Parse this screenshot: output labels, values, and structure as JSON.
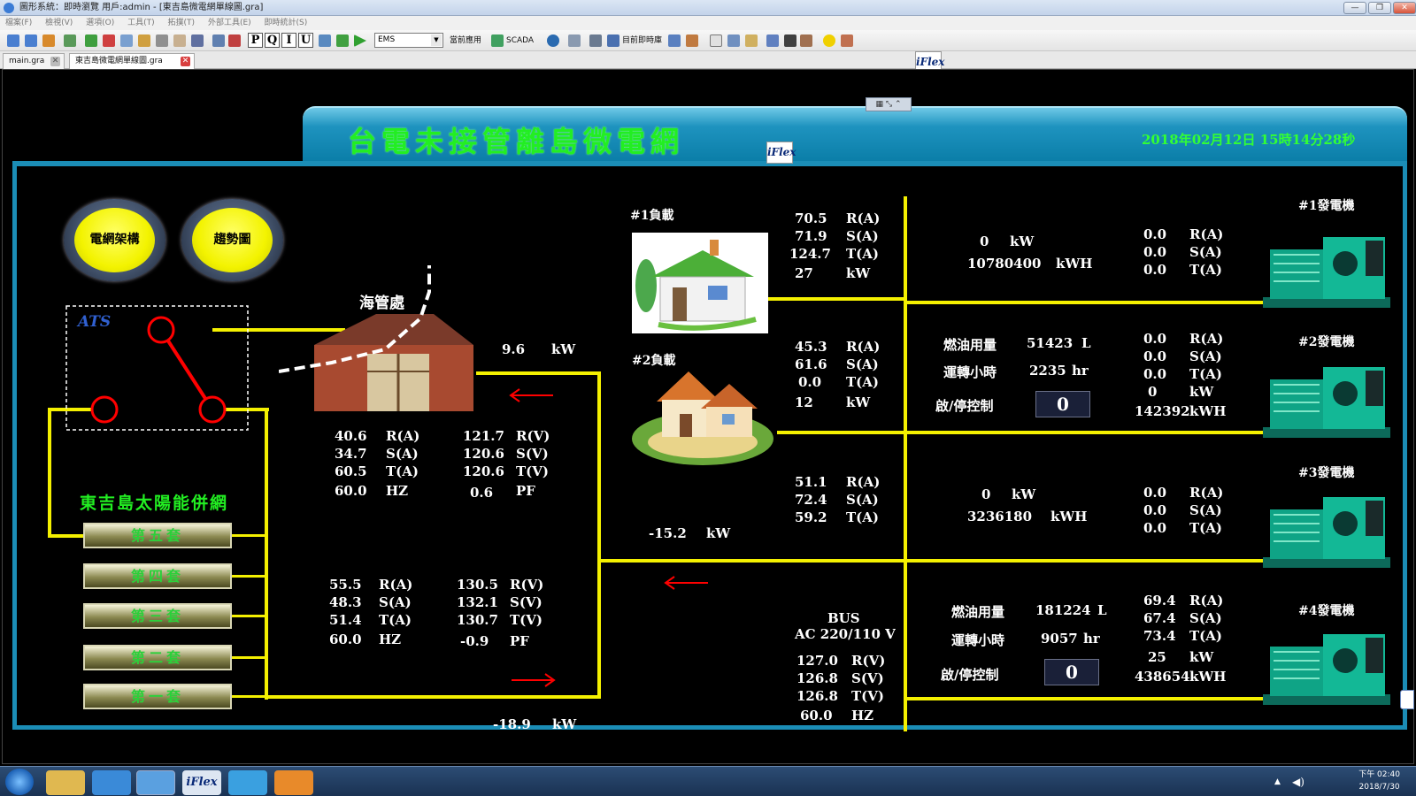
{
  "window": {
    "title": "圖形系統：即時瀏覽 用戶:admin - [東吉島微電網單線圖.gra]"
  },
  "menu": [
    "檔案(F)",
    "檢視(V)",
    "選項(O)",
    "工具(T)",
    "拓撲(T)",
    "外部工具(E)",
    "即時統計(S)"
  ],
  "toolbar": {
    "pq": [
      "P",
      "Q",
      "I",
      "U"
    ],
    "ems_value": "EMS",
    "current_app": "當前應用",
    "scada": "SCADA",
    "realtime_lib": "目前即時庫"
  },
  "tabs": [
    "main.gra",
    "東吉島微電網單線圖.gra"
  ],
  "iflex": "iFlex",
  "header": {
    "title": "台電未接管離島微電網",
    "datetime": "2018年02月12日  15時14分28秒"
  },
  "buttons": {
    "grid_arch": "電網架構",
    "trend": "趨勢圖"
  },
  "ats_label": "ATS",
  "sea_cable_label": "海管處",
  "sea_cable_kw": {
    "value": "9.6",
    "unit": "kW"
  },
  "solar": {
    "title": "東吉島太陽能併網",
    "sets": [
      "第五套",
      "第四套",
      "第三套",
      "第二套",
      "第一套"
    ]
  },
  "units": {
    "ra": "R(A)",
    "sa": "S(A)",
    "ta": "T(A)",
    "rv": "R(V)",
    "sv": "S(V)",
    "tv": "T(V)",
    "hz": "HZ",
    "pf": "PF",
    "kw": "kW",
    "kwh": "kWH",
    "hr": "hr",
    "l": "L"
  },
  "meter_upper": {
    "ra": "40.6",
    "sa": "34.7",
    "ta": "60.5",
    "hz": "60.0",
    "rv": "121.7",
    "sv": "120.6",
    "tv": "120.6",
    "pf": "0.6"
  },
  "meter_lower": {
    "ra": "55.5",
    "sa": "48.3",
    "ta": "51.4",
    "hz": "60.0",
    "rv": "130.5",
    "sv": "132.1",
    "tv": "130.7",
    "pf": "-0.9"
  },
  "solar_kw": {
    "value": "-18.9",
    "unit": "kW"
  },
  "mid_kw": {
    "value": "-15.2",
    "unit": "kW"
  },
  "load1": {
    "label": "#1負載",
    "ra": "70.5",
    "sa": "71.9",
    "ta": "124.7",
    "kw": "27"
  },
  "load2": {
    "label": "#2負載",
    "ra": "45.3",
    "sa": "61.6",
    "ta": "0.0",
    "kw": "12"
  },
  "feeder3": {
    "ra": "51.1",
    "sa": "72.4",
    "ta": "59.2"
  },
  "bus": {
    "line1": "BUS",
    "line2": "AC 220/110 V",
    "rv": "127.0",
    "sv": "126.8",
    "tv": "126.8",
    "hz": "60.0"
  },
  "gen1": {
    "label": "#1發電機",
    "kw": "0",
    "kwh": "10780400",
    "ra": "0.0",
    "sa": "0.0",
    "ta": "0.0"
  },
  "gen2": {
    "label": "#2發電機",
    "fuel_label": "燃油用量",
    "fuel": "51423",
    "hours_label": "運轉小時",
    "hours": "2235",
    "ctrl_label": "啟/停控制",
    "ctrl": "0",
    "ra": "0.0",
    "sa": "0.0",
    "ta": "0.0",
    "kw": "0",
    "kwh": "142392"
  },
  "gen3": {
    "label": "#3發電機",
    "kw": "0",
    "kwh": "3236180",
    "ra": "0.0",
    "sa": "0.0",
    "ta": "0.0"
  },
  "gen4": {
    "label": "#4發電機",
    "fuel_label": "燃油用量",
    "fuel": "181224",
    "hours_label": "運轉小時",
    "hours": "9057",
    "ctrl_label": "啟/停控制",
    "ctrl": "0",
    "ra": "69.4",
    "sa": "67.4",
    "ta": "73.4",
    "kw": "25",
    "kwh": "438654"
  },
  "clock": {
    "ampm_time": "下午 02:40",
    "date": "2018/7/30"
  },
  "colors": {
    "bus": "#f4f000",
    "title_green": "#22ee22",
    "header_blue": "#1e93bf",
    "ats_red": "#ff0000"
  }
}
